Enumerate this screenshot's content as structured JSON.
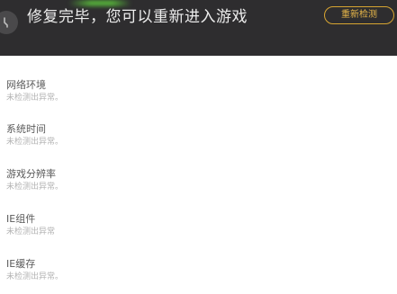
{
  "header": {
    "title": "修复完毕，您可以重新进入游戏",
    "retest_label": "重新检测"
  },
  "checks": [
    {
      "name": "网络环境",
      "status": "未检测出异常。"
    },
    {
      "name": "系统时间",
      "status": "未检测出异常。"
    },
    {
      "name": "游戏分辨率",
      "status": "未检测出异常。"
    },
    {
      "name": "IE组件",
      "status": "未检测出异常"
    },
    {
      "name": "IE缓存",
      "status": "未检测出异常。"
    }
  ],
  "colors": {
    "header_bg": "#2e2d2f",
    "accent": "#d8a531"
  },
  "icons": {
    "corner": "wrench-icon"
  }
}
